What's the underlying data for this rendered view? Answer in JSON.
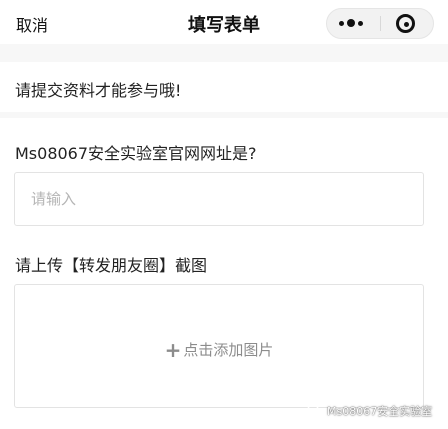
{
  "navbar": {
    "back_label": "取消",
    "title": "填写表单",
    "capsule": {
      "more_icon": "more-dots-icon",
      "close_icon": "target-close-icon"
    }
  },
  "notice": {
    "text": "请提交资料才能参与哦!"
  },
  "form": {
    "question_1": {
      "label": "Ms08067安全实验室官网网址是?",
      "value": "",
      "placeholder": "请输入"
    },
    "question_2": {
      "label": "请上传【转发朋友圈】截图",
      "upload_icon": "plus-icon",
      "upload_plus": "+",
      "upload_label": "点击添加图片"
    }
  },
  "watermark": {
    "icon": "wechat-icon",
    "text": "Ms08067安全实验室"
  }
}
